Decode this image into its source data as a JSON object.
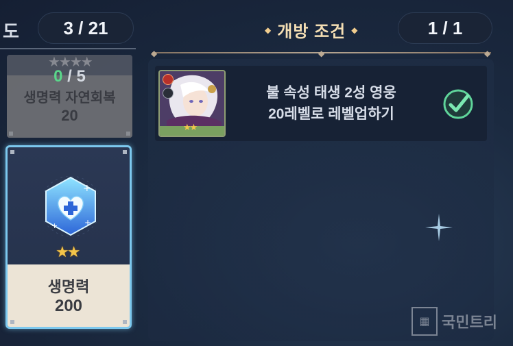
{
  "header": {
    "left_title_fragment": "도",
    "left_progress": "3 / 21",
    "condition_title": "개방 조건",
    "condition_progress": "1 / 1"
  },
  "skill_cards": [
    {
      "name": "생명력 자연회복",
      "value": "20",
      "progress_done": "0",
      "progress_total": " / 5",
      "state": "inactive"
    },
    {
      "name": "생명력",
      "value": "200",
      "stars": 2,
      "state": "selected",
      "icon": "heart-plus-hexagon-icon"
    }
  ],
  "conditions": [
    {
      "line1": "불 속성 태생 2성 영웅",
      "line2": "20레벨로 레벨업하기",
      "completed": true,
      "hero_stars": 2,
      "element_icon": "fire-element-icon",
      "class_icon": "archer-class-icon"
    }
  ],
  "watermark": {
    "text": "국민트리"
  },
  "colors": {
    "accent_gold": "#f4deb3",
    "selected_border": "#7cc8ee",
    "progress_green": "#5ee08f",
    "check_green": "#5fd49a"
  }
}
